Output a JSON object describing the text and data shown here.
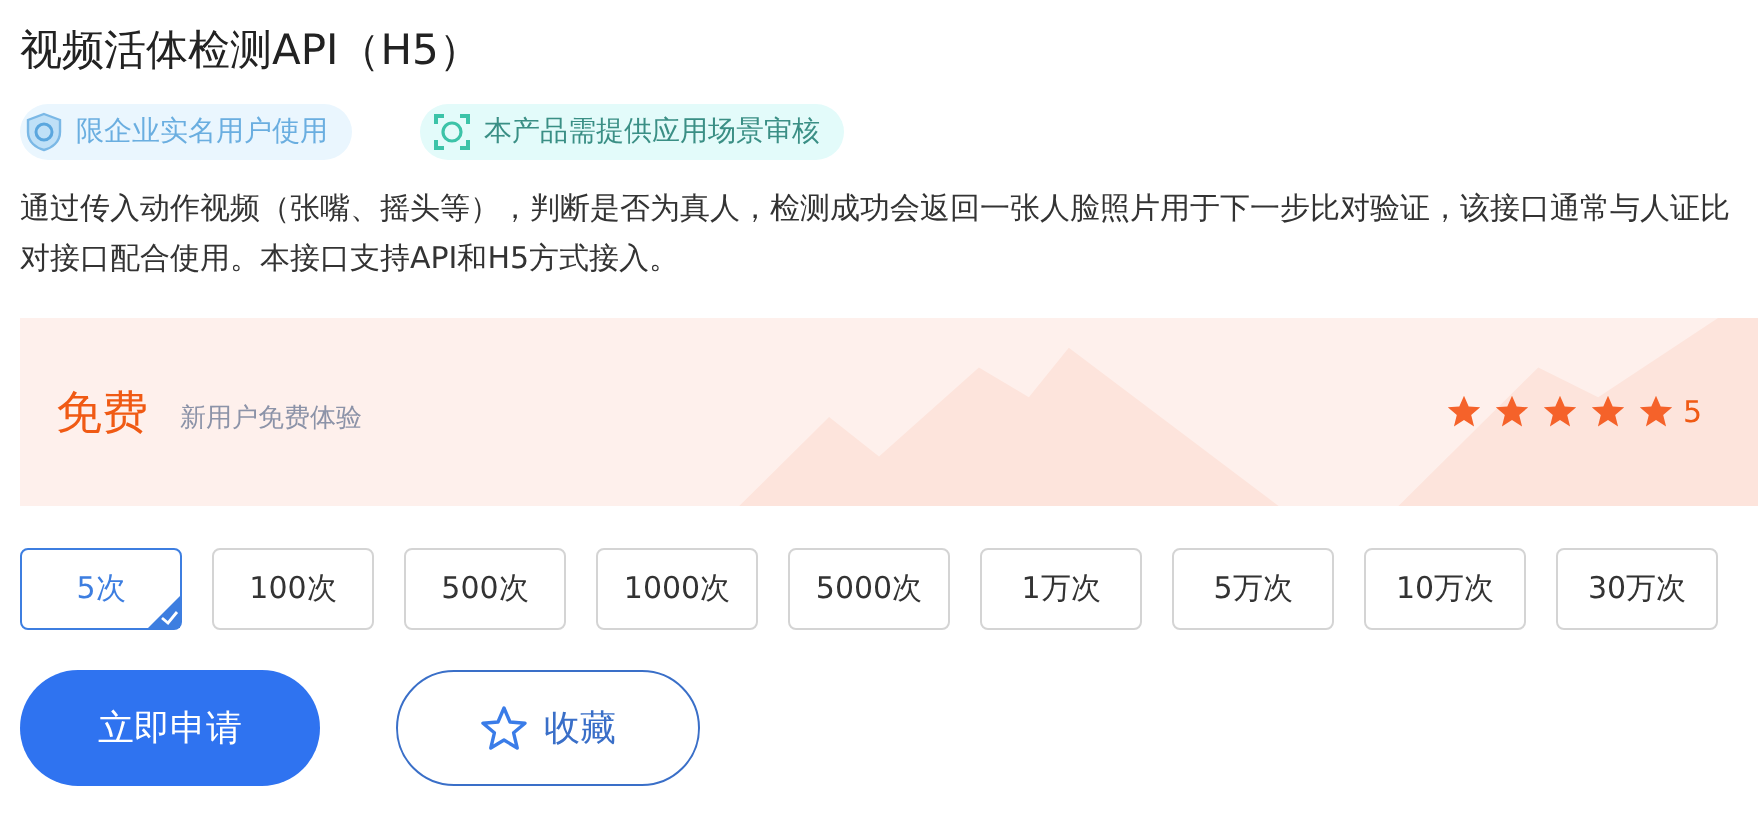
{
  "title": "视频活体检测API（H5）",
  "tags": [
    {
      "kind": "enterprise",
      "label": "限企业实名用户使用"
    },
    {
      "kind": "review",
      "label": "本产品需提供应用场景审核"
    }
  ],
  "description": "通过传入动作视频（张嘴、摇头等），判断是否为真人，检测成功会返回一张人脸照片用于下一步比对验证，该接口通常与人证比对接口配合使用。本接口支持API和H5方式接入。",
  "price": {
    "label": "免费",
    "note": "新用户免费体验",
    "stars": 5,
    "rating": "5"
  },
  "packages": [
    {
      "label": "5次",
      "selected": true
    },
    {
      "label": "100次",
      "selected": false
    },
    {
      "label": "500次",
      "selected": false
    },
    {
      "label": "1000次",
      "selected": false
    },
    {
      "label": "5000次",
      "selected": false
    },
    {
      "label": "1万次",
      "selected": false
    },
    {
      "label": "5万次",
      "selected": false
    },
    {
      "label": "10万次",
      "selected": false
    },
    {
      "label": "30万次",
      "selected": false
    }
  ],
  "actions": {
    "apply": "立即申请",
    "favorite": "收藏"
  }
}
